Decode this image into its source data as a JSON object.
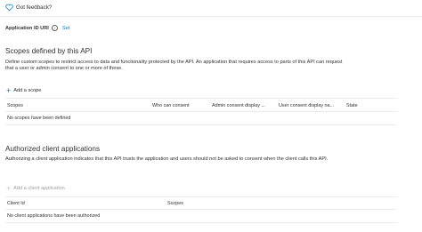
{
  "feedback": {
    "label": "Got feedback?",
    "icon": "heart-icon"
  },
  "app_id_uri": {
    "label": "Application ID URI",
    "info_icon": "info-icon",
    "link": "Set"
  },
  "scopes": {
    "title": "Scopes defined by this API",
    "description": "Define custom scopes to restrict access to data and functionality protected by the API. An application that requires access to parts of this API can request that a user or admin consent to one or more of these.",
    "add_label": "Add a scope",
    "columns": [
      "Scopes",
      "Who can consent",
      "Admin consent display ...",
      "User consent display na...",
      "State"
    ],
    "empty_message": "No scopes have been defined"
  },
  "authorized": {
    "title": "Authorized client applications",
    "description": "Authorizing a client application indicates that this API trusts the application and users should not be asked to consent when the client calls this API.",
    "add_label": "Add a client application",
    "columns": [
      "Client Id",
      "Scopes"
    ],
    "empty_message": "No client applications have been authorized"
  },
  "colors": {
    "accent": "#0078d4",
    "text": "#323130",
    "disabled": "#a19f9d",
    "divider": "#edebe9"
  }
}
